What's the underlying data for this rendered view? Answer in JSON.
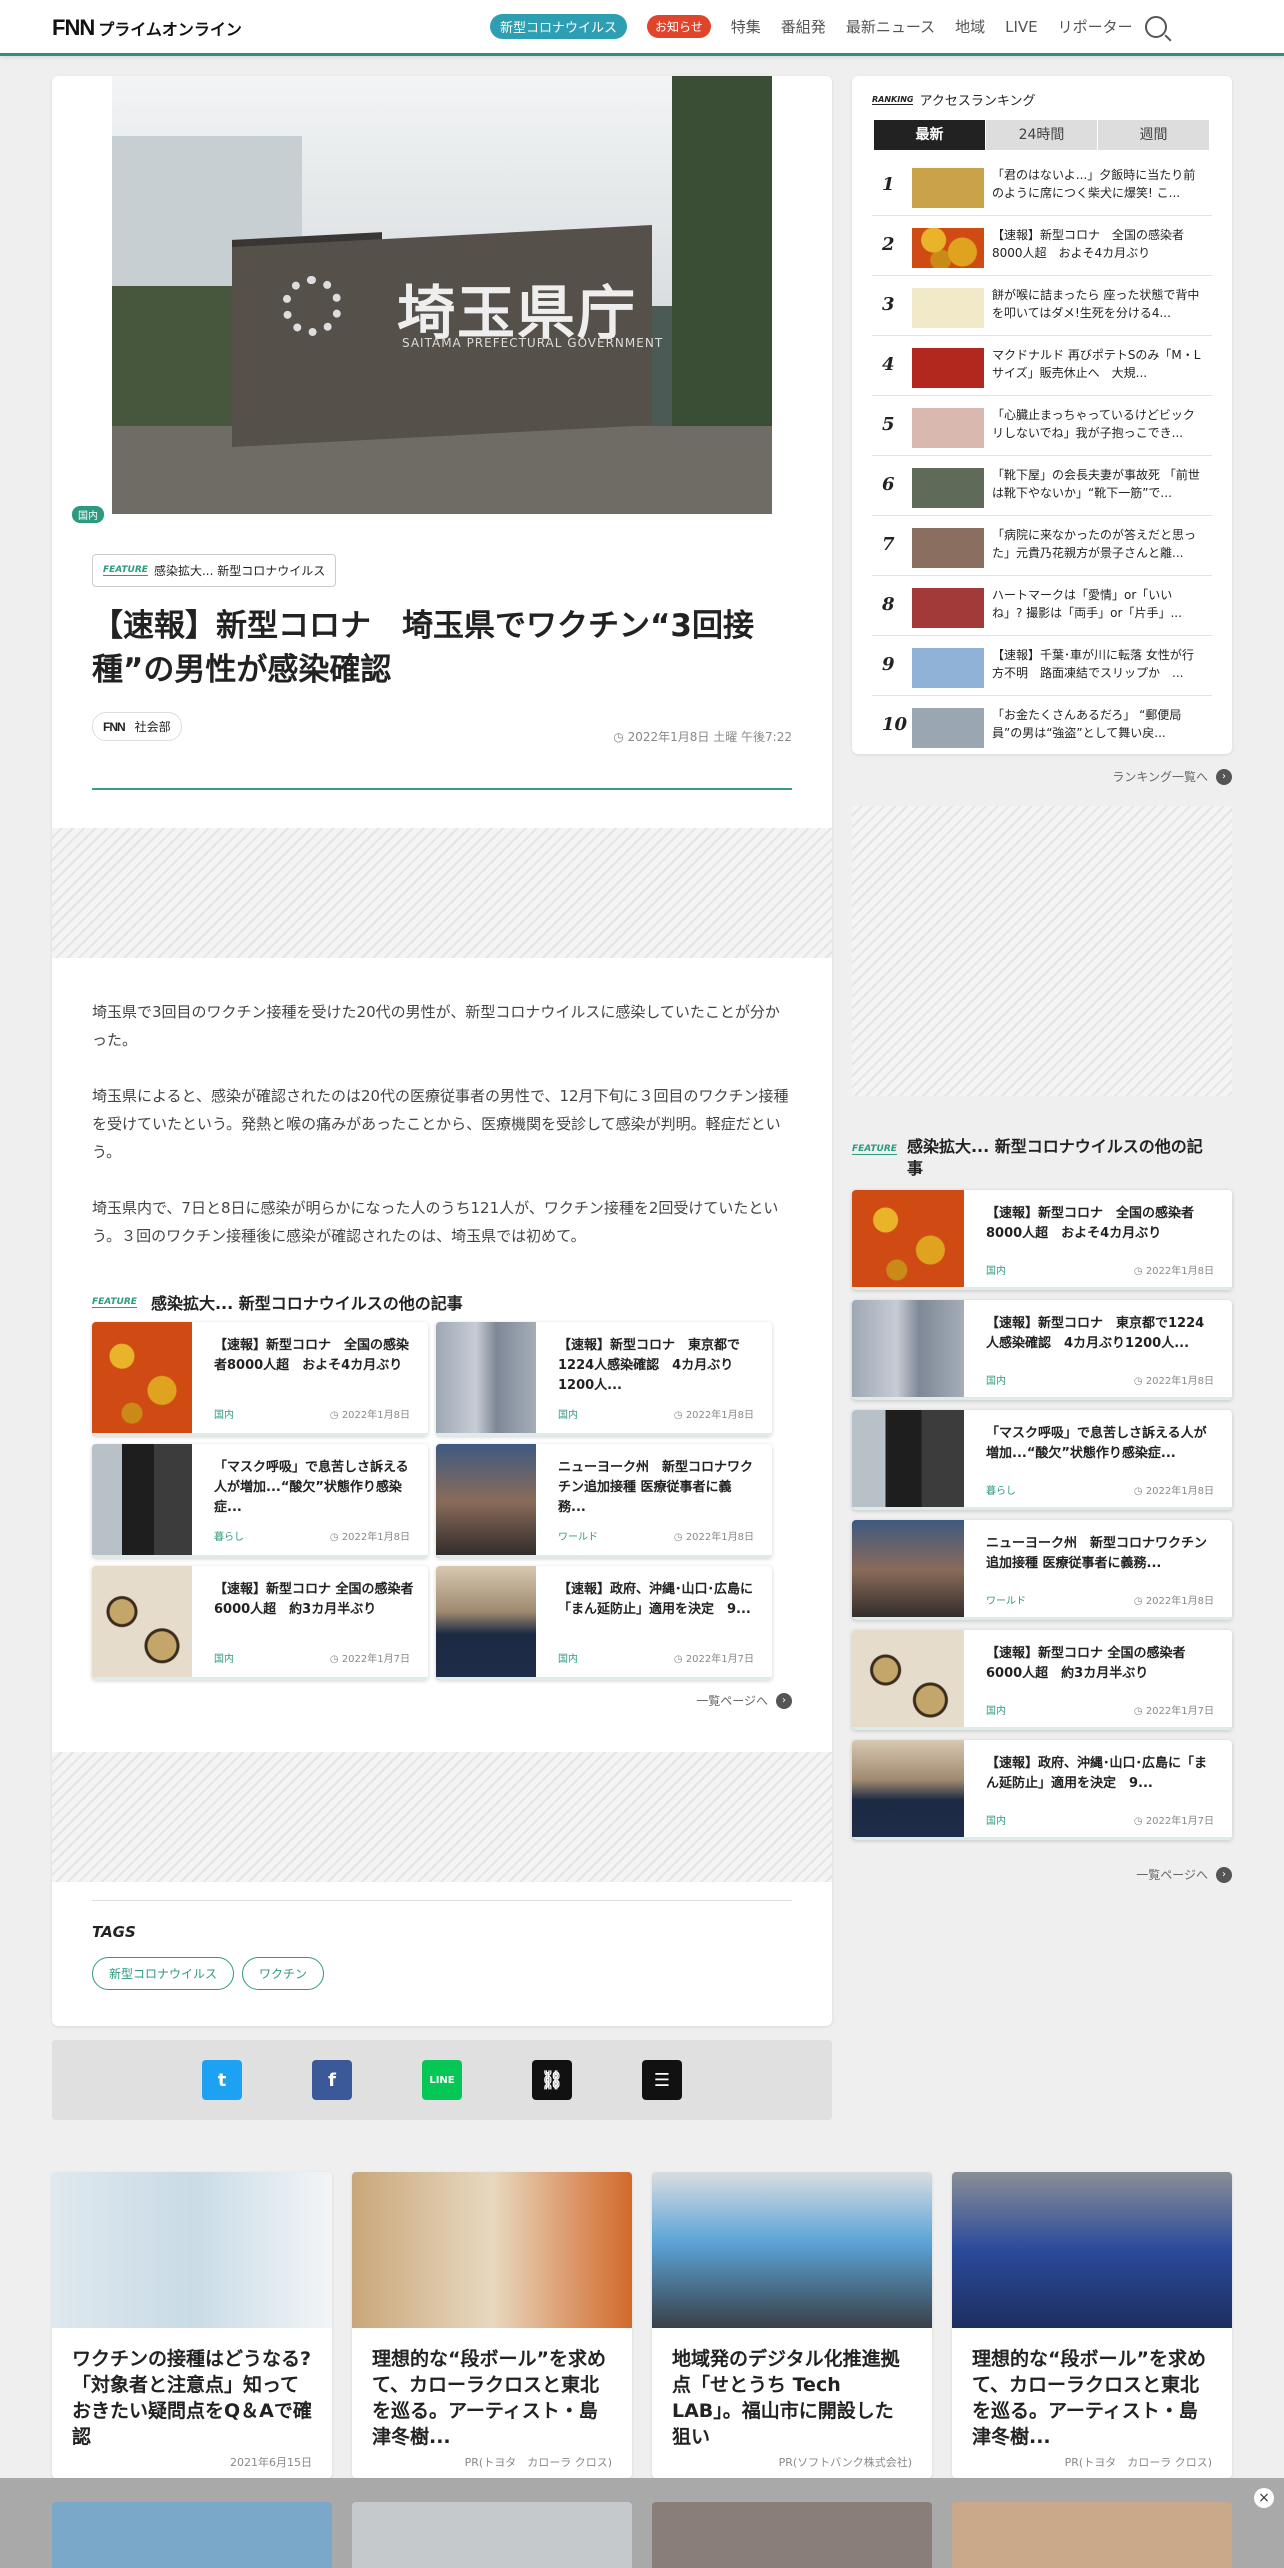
{
  "header": {
    "logo_mark": "FNN",
    "logo_text": "プライムオンライン",
    "nav": [
      "新型コロナウイルス",
      "お知らせ",
      "特集",
      "番組発",
      "最新ニュース",
      "地域",
      "LIVE",
      "リポーター"
    ]
  },
  "article": {
    "category_badge": "国内",
    "hero_sign_jp": "埼玉県庁",
    "hero_sign_en": "SAITAMA PREFECTURAL GOVERNMENT",
    "feature_tag": "FEATURE",
    "feature_name": "感染拡大... 新型コロナウイルス",
    "title": "【速報】新型コロナ　埼玉県でワクチン“3回接種”の男性が感染確認",
    "source_logo": "FNN",
    "source_dept": "社会部",
    "date": "2022年1月8日 土曜 午後7:22",
    "paragraphs": [
      "埼玉県で3回目のワクチン接種を受けた20代の男性が、新型コロナウイルスに感染していたことが分かった。",
      "埼玉県によると、感染が確認されたのは20代の医療従事者の男性で、12月下旬に３回目のワクチン接種を受けていたという。発熱と喉の痛みがあったことから、医療機関を受診して感染が判明。軽症だという。",
      "埼玉県内で、7日と8日に感染が明らかになった人のうち121人が、ワクチン接種を2回受けていたという。３回のワクチン接種後に感染が確認されたのは、埼玉県では初めて。"
    ],
    "related_heading": "感染拡大... 新型コロナウイルスの他の記事",
    "related": [
      {
        "title": "【速報】新型コロナ　全国の感染者8000人超　およそ4カ月ぶり",
        "genre": "国内",
        "date": "2022年1月8日"
      },
      {
        "title": "【速報】新型コロナ　東京都で1224人感染確認　4カ月ぶり1200人...",
        "genre": "国内",
        "date": "2022年1月8日"
      },
      {
        "title": "「マスク呼吸」で息苦しさ訴える人が増加...“酸欠”状態作り感染症...",
        "genre": "暮らし",
        "date": "2022年1月8日"
      },
      {
        "title": "ニューヨーク州　新型コロナワクチン追加接種 医療従事者に義務...",
        "genre": "ワールド",
        "date": "2022年1月8日"
      },
      {
        "title": "【速報】新型コロナ 全国の感染者6000人超　約3カ月半ぶり",
        "genre": "国内",
        "date": "2022年1月7日"
      },
      {
        "title": "【速報】政府、沖縄･山口･広島に「まん延防止」適用を決定　9...",
        "genre": "国内",
        "date": "2022年1月7日"
      }
    ],
    "more_label": "一覧ページへ",
    "tags_label": "TAGS",
    "tags": [
      "新型コロナウイルス",
      "ワクチン"
    ]
  },
  "ranking": {
    "badge": "RANKING",
    "title": "アクセスランキング",
    "tabs": [
      "最新",
      "24時間",
      "週間"
    ],
    "items": [
      {
        "n": "1",
        "title": "「君のはないよ...」夕飯時に当たり前のように席につく柴犬に爆笑! こ..."
      },
      {
        "n": "2",
        "title": "【速報】新型コロナ　全国の感染者8000人超　およそ4カ月ぶり"
      },
      {
        "n": "3",
        "title": "餅が喉に詰まったら 座った状態で背中を叩いてはダメ!生死を分ける4..."
      },
      {
        "n": "4",
        "title": "マクドナルド 再びポテトSのみ「M・Lサイズ」販売休止へ　大規..."
      },
      {
        "n": "5",
        "title": "「心臓止まっちゃっているけどビックリしないでね」我が子抱っこでき..."
      },
      {
        "n": "6",
        "title": "「靴下屋」の会長夫妻が事故死 「前世は靴下やないか」“靴下一筋”で..."
      },
      {
        "n": "7",
        "title": "「病院に来なかったのが答えだと思った」元貴乃花親方が景子さんと離..."
      },
      {
        "n": "8",
        "title": "ハートマークは「愛情」or「いいね」? 撮影は「両手」or「片手」..."
      },
      {
        "n": "9",
        "title": "【速報】千葉･車が川に転落 女性が行方不明　路面凍結でスリップか　..."
      },
      {
        "n": "10",
        "title": "「お金たくさんあるだろ」 “郵便局員”の男は“強盗”として舞い戻..."
      }
    ],
    "more_label": "ランキング一覧へ"
  },
  "side_feature": {
    "tag": "FEATURE",
    "heading": "感染拡大... 新型コロナウイルスの他の記事",
    "items": [
      {
        "title": "【速報】新型コロナ　全国の感染者8000人超　およそ4カ月ぶり",
        "genre": "国内",
        "date": "2022年1月8日"
      },
      {
        "title": "【速報】新型コロナ　東京都で1224人感染確認　4カ月ぶり1200人...",
        "genre": "国内",
        "date": "2022年1月8日"
      },
      {
        "title": "「マスク呼吸」で息苦しさ訴える人が増加...“酸欠”状態作り感染症...",
        "genre": "暮らし",
        "date": "2022年1月8日"
      },
      {
        "title": "ニューヨーク州　新型コロナワクチン追加接種 医療従事者に義務...",
        "genre": "ワールド",
        "date": "2022年1月8日"
      },
      {
        "title": "【速報】新型コロナ 全国の感染者6000人超　約3カ月半ぶり",
        "genre": "国内",
        "date": "2022年1月7日"
      },
      {
        "title": "【速報】政府、沖縄･山口･広島に「まん延防止」適用を決定　9...",
        "genre": "国内",
        "date": "2022年1月7日"
      }
    ],
    "more_label": "一覧ページへ"
  },
  "promos": [
    {
      "title": "ワクチンの接種はどうなる?「対象者と注意点」知っておきたい疑問点をQ＆Aで確認",
      "meta": "2021年6月15日"
    },
    {
      "title": "理想的な“段ボール”を求めて、カローラクロスと東北を巡る。アーティスト・島津冬樹...",
      "meta": "PR(トヨタ　カローラ クロス)"
    },
    {
      "title": "地域発のデジタル化推進拠点「せとうち Tech LAB」。福山市に開設した狙い",
      "meta": "PR(ソフトバンク株式会社)"
    },
    {
      "title": "理想的な“段ボール”を求めて、カローラクロスと東北を巡る。アーティスト・島津冬樹...",
      "meta": "PR(トヨタ　カローラ クロス)"
    }
  ],
  "colors": {
    "accent": "#2d9a7f",
    "header_rule": "#2d8f86",
    "covid_pill": "#2e9fb3",
    "notice_pill": "#e0452c"
  }
}
